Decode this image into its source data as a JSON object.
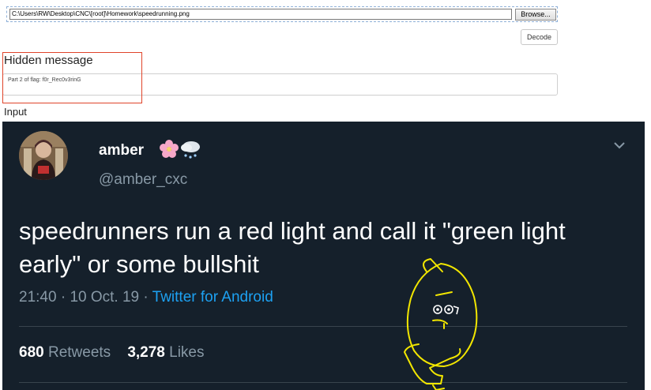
{
  "file_input": {
    "path": "C:\\Users\\RW\\Desktop\\CNC\\[root]\\Homework\\speedrunning.png",
    "browse_label": "Browse..."
  },
  "decode_label": "Decode",
  "hidden_message": {
    "title": "Hidden message",
    "value": "Part 2 of flag: f0r_Rec0v3rinG"
  },
  "input_label": "Input",
  "tweet": {
    "author_name": "amber",
    "author_emoji": [
      "cherry-blossom",
      "cloud-with-snow"
    ],
    "handle": "@amber_cxc",
    "text": "speedrunners run a red light and call it \"green light early\" or some bullshit",
    "time": "21:40",
    "date": "10 Oct. 19",
    "separator": "·",
    "source": "Twitter for Android",
    "retweets_count": "680",
    "retweets_label": "Retweets",
    "likes_count": "3,278",
    "likes_label": "Likes"
  },
  "colors": {
    "tweet_bg": "#15202b",
    "link": "#1da1f2",
    "muted": "#8899a6",
    "highlight_border": "#e0442a",
    "scribble": "#f2e600"
  }
}
